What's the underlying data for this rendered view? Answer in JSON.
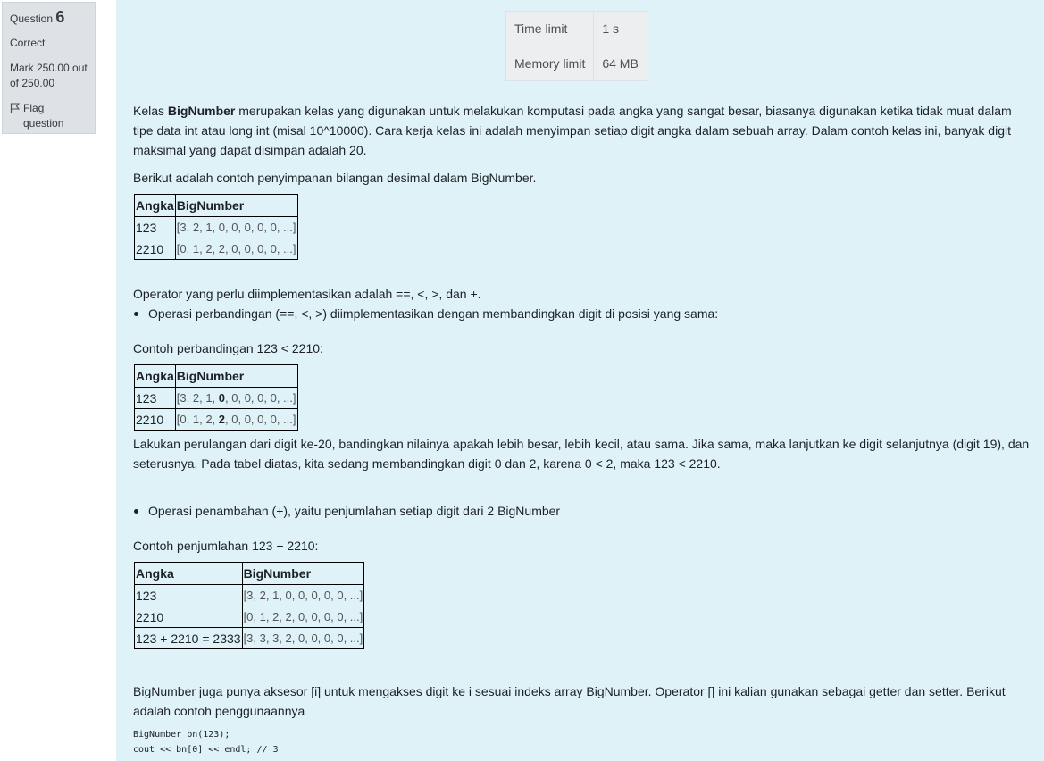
{
  "info": {
    "question_word": "Question",
    "question_number": "6",
    "status": "Correct",
    "mark": "Mark 250.00 out of 250.00",
    "flag_label": "Flag question"
  },
  "limits": [
    {
      "label": "Time limit",
      "value": "1 s"
    },
    {
      "label": "Memory limit",
      "value": "64 MB"
    }
  ],
  "intro": {
    "pre": "Kelas ",
    "bold": "BigNumber",
    "post": " merupakan kelas yang digunakan untuk melakukan komputasi pada angka yang sangat besar, biasanya digunakan ketika tidak muat dalam tipe data int atau long int (misal 10^10000). Cara kerja kelas ini adalah menyimpan setiap digit angka dalam sebuah array. Dalam contoh kelas ini, banyak digit maksimal yang dapat disimpan adalah 20."
  },
  "storage_intro": "Berikut adalah contoh penyimpanan bilangan desimal dalam BigNumber.",
  "table1": {
    "headers": [
      "Angka",
      "BigNumber"
    ],
    "rows": [
      {
        "angka": "123",
        "bignumber": "[3, 2, 1, 0, 0, 0, 0, 0, ...]"
      },
      {
        "angka": "2210",
        "bignumber": "[0, 1, 2, 2, 0, 0, 0, 0, ...]"
      }
    ]
  },
  "operators_text": "Operator yang perlu diimplementasikan adalah ==, <, >, dan +.",
  "bullet_compare": "Operasi perbandingan (==, <, >) diimplementasikan dengan membandingkan digit di posisi yang sama:",
  "compare_example": "Contoh perbandingan 123 < 2210:",
  "table2": {
    "headers": [
      "Angka",
      "BigNumber"
    ],
    "rows": [
      {
        "angka": "123",
        "pre": "[3, 2, 1, ",
        "bold": "0",
        "post": ", 0, 0, 0, 0, ...]"
      },
      {
        "angka": "2210",
        "pre": "[0, 1, 2, ",
        "bold": "2",
        "post": ", 0, 0, 0, 0, ...]"
      }
    ]
  },
  "compare_explain": "Lakukan perulangan dari digit ke-20, bandingkan nilainya apakah lebih besar, lebih kecil, atau sama. Jika sama, maka lanjutkan ke digit selanjutnya (digit 19), dan seterusnya. Pada tabel diatas, kita sedang membandingkan digit 0 dan 2, karena 0 < 2, maka 123 < 2210.",
  "bullet_add": "Operasi penambahan (+), yaitu penjumlahan setiap digit dari 2 BigNumber",
  "add_example": "Contoh penjumlahan 123 + 2210:",
  "table3": {
    "headers": [
      "Angka",
      "BigNumber"
    ],
    "rows": [
      {
        "angka": "123",
        "bignumber": "[3, 2, 1, 0, 0, 0, 0, 0, ...]"
      },
      {
        "angka": "2210",
        "bignumber": "[0, 1, 2, 2, 0, 0, 0, 0, ...]"
      },
      {
        "angka": "123 + 2210 = 2333",
        "bignumber": "[3, 3, 3, 2, 0, 0, 0, 0, ...]"
      }
    ]
  },
  "accessor_text": "BigNumber juga punya aksesor [i] untuk mengakses digit ke i sesuai indeks array BigNumber. Operator [] ini kalian gunakan sebagai getter dan setter. Berikut adalah contoh penggunaannya",
  "code_lines": [
    "BigNumber bn(123);",
    "cout << bn[0] << endl; // 3"
  ]
}
